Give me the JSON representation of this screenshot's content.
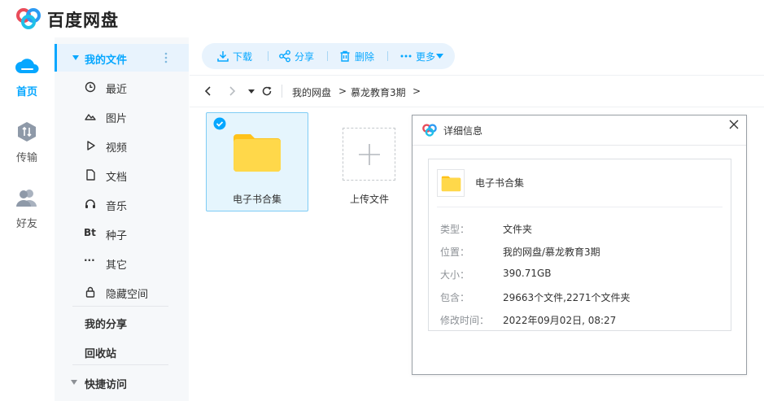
{
  "app": {
    "logo_text": "百度网盘"
  },
  "rail": {
    "items": [
      {
        "label": "首页",
        "icon": "cloud-icon",
        "active": true
      },
      {
        "label": "传输",
        "icon": "transfer-icon",
        "active": false
      },
      {
        "label": "好友",
        "icon": "friends-icon",
        "active": false
      }
    ]
  },
  "sidebar": {
    "my_files": "我的文件",
    "items": [
      {
        "label": "最近",
        "icon": "clock-icon"
      },
      {
        "label": "图片",
        "icon": "image-icon"
      },
      {
        "label": "视频",
        "icon": "play-icon"
      },
      {
        "label": "文档",
        "icon": "document-icon"
      },
      {
        "label": "音乐",
        "icon": "headphones-icon"
      },
      {
        "label": "种子",
        "icon_text": "Bt"
      },
      {
        "label": "其它",
        "icon_text": "···"
      },
      {
        "label": "隐藏空间",
        "icon": "lock-icon"
      }
    ],
    "my_share": "我的分享",
    "recycle": "回收站",
    "quick_access": "快捷访问"
  },
  "toolbar": {
    "download": "下载",
    "share": "分享",
    "delete": "删除",
    "more": "更多"
  },
  "breadcrumb": {
    "root": "我的网盘",
    "sep": ">",
    "current": "慕龙教育3期"
  },
  "files": {
    "folder_name": "电子书合集",
    "upload_label": "上传文件"
  },
  "detail": {
    "title": "详细信息",
    "name": "电子书合集",
    "rows": [
      {
        "key": "类型：",
        "value": "文件夹"
      },
      {
        "key": "位置：",
        "value": "我的网盘/慕龙教育3期"
      },
      {
        "key": "大小：",
        "value": "390.71GB"
      },
      {
        "key": "包含：",
        "value": "29663个文件,2271个文件夹"
      },
      {
        "key": "修改时间：",
        "value": "2022年09月02日, 08:27"
      }
    ]
  },
  "colors": {
    "accent": "#06a7ff",
    "folder": "#ffd234",
    "sidebar_bg": "#f6f8fa"
  }
}
